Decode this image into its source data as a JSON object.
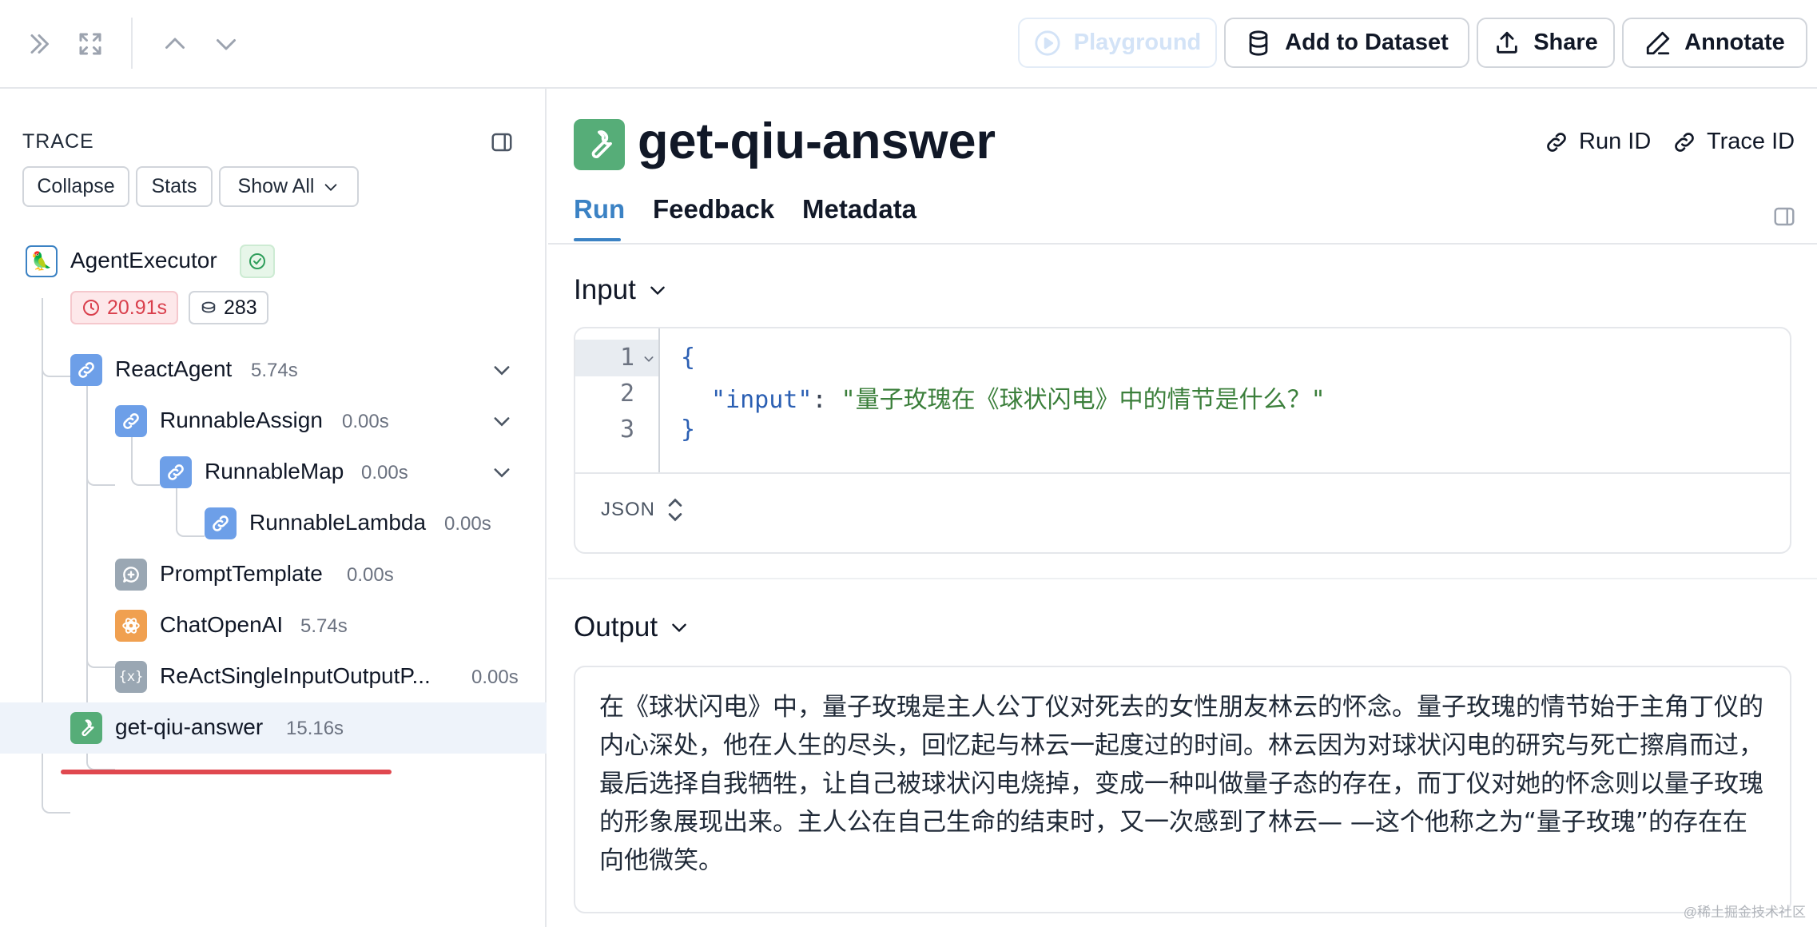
{
  "toolbar": {
    "playground_label": "Playground",
    "add_dataset_label": "Add to Dataset",
    "share_label": "Share",
    "annotate_label": "Annotate"
  },
  "trace": {
    "title": "TRACE",
    "collapse_label": "Collapse",
    "stats_label": "Stats",
    "show_all_label": "Show All",
    "root": {
      "label": "AgentExecutor",
      "latency": "20.91s",
      "tokens": "283"
    },
    "nodes": [
      {
        "label": "ReactAgent",
        "time": "5.74s"
      },
      {
        "label": "RunnableAssign",
        "time": "0.00s"
      },
      {
        "label": "RunnableMap",
        "time": "0.00s"
      },
      {
        "label": "RunnableLambda",
        "time": "0.00s"
      },
      {
        "label": "PromptTemplate",
        "time": "0.00s"
      },
      {
        "label": "ChatOpenAI",
        "time": "5.74s"
      },
      {
        "label": "ReActSingleInputOutputP...",
        "time": "0.00s"
      },
      {
        "label": "get-qiu-answer",
        "time": "15.16s"
      }
    ]
  },
  "run": {
    "title": "get-qiu-answer",
    "run_id_label": "Run ID",
    "trace_id_label": "Trace ID",
    "tabs": [
      {
        "label": "Run"
      },
      {
        "label": "Feedback"
      },
      {
        "label": "Metadata"
      }
    ],
    "input_title": "Input",
    "code_lines": [
      "1",
      "2",
      "3"
    ],
    "code_open": "{",
    "code_key": "\"input\"",
    "code_colon": ": ",
    "code_value": "\"量子玫瑰在《球状闪电》中的情节是什么？\"",
    "code_close": "}",
    "format_label": "JSON",
    "output_title": "Output",
    "output_text": "在《球状闪电》中，量子玫瑰是主人公丁仪对死去的女性朋友林云的怀念。量子玫瑰的情节始于主角丁仪的内心深处，他在人生的尽头，回忆起与林云一起度过的时间。林云因为对球状闪电的研究与死亡擦肩而过，最后选择自我牺牲，让自己被球状闪电烧掉，变成一种叫做量子态的存在，而丁仪对她的怀念则以量子玫瑰的形象展现出来。主人公在自己生命的结束时，又一次感到了林云— —这个他称之为“量子玫瑰”的存在在向他微笑。"
  },
  "watermark": "@稀土掘金技术社区",
  "colors": {
    "accent": "#3b82c4",
    "tool_green": "#56ad78",
    "chain_blue": "#6d9fe8",
    "openai_orange": "#f0a050",
    "latency_red": "#d93f4c"
  }
}
